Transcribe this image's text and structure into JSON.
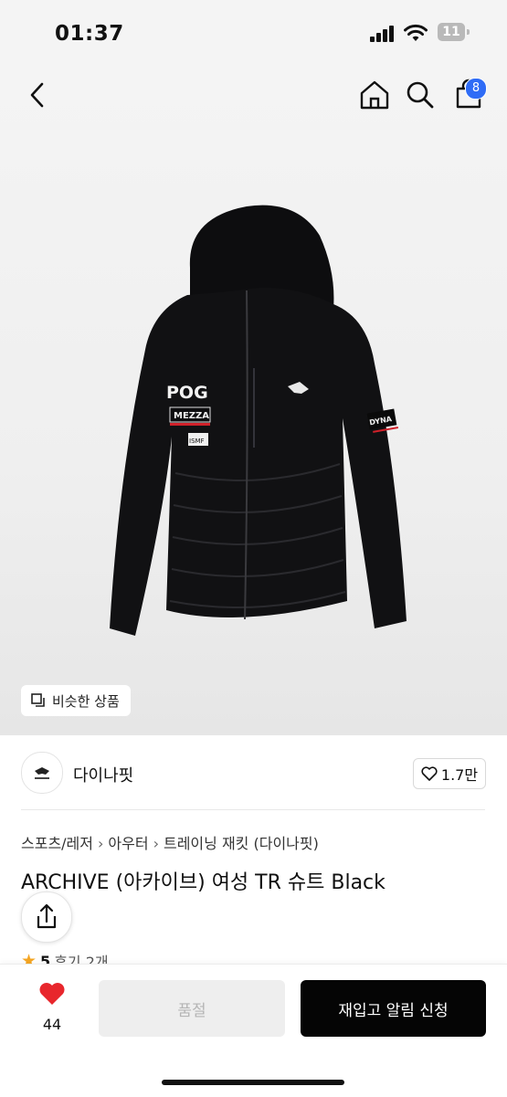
{
  "status": {
    "time": "01:37",
    "battery": "11"
  },
  "nav": {
    "cart_count": "8"
  },
  "hero": {
    "similar_label": "비슷한 상품"
  },
  "seller": {
    "brand": "다이나핏",
    "likes": "1.7만"
  },
  "product": {
    "breadcrumb": [
      "스포츠/레저",
      "아우터",
      "트레이닝 재킷 (다이나핏)"
    ],
    "title": "ARCHIVE (아카이브) 여성 TR 슈트 Black",
    "rating": "5",
    "reviews": "후기 2개"
  },
  "bottom": {
    "wish_count": "44",
    "soldout_label": "품절",
    "restock_label": "재입고 알림 신청"
  },
  "colors": {
    "accent_blue": "#2f6cf6",
    "heart_red": "#e8262c",
    "star_orange": "#f5a623",
    "primary_black": "#050505"
  },
  "jacket_prints": {
    "chest_logo": "POG",
    "patch_1": "MEZZA",
    "patch_2": "ISMF",
    "sleeve": "DYNA"
  }
}
